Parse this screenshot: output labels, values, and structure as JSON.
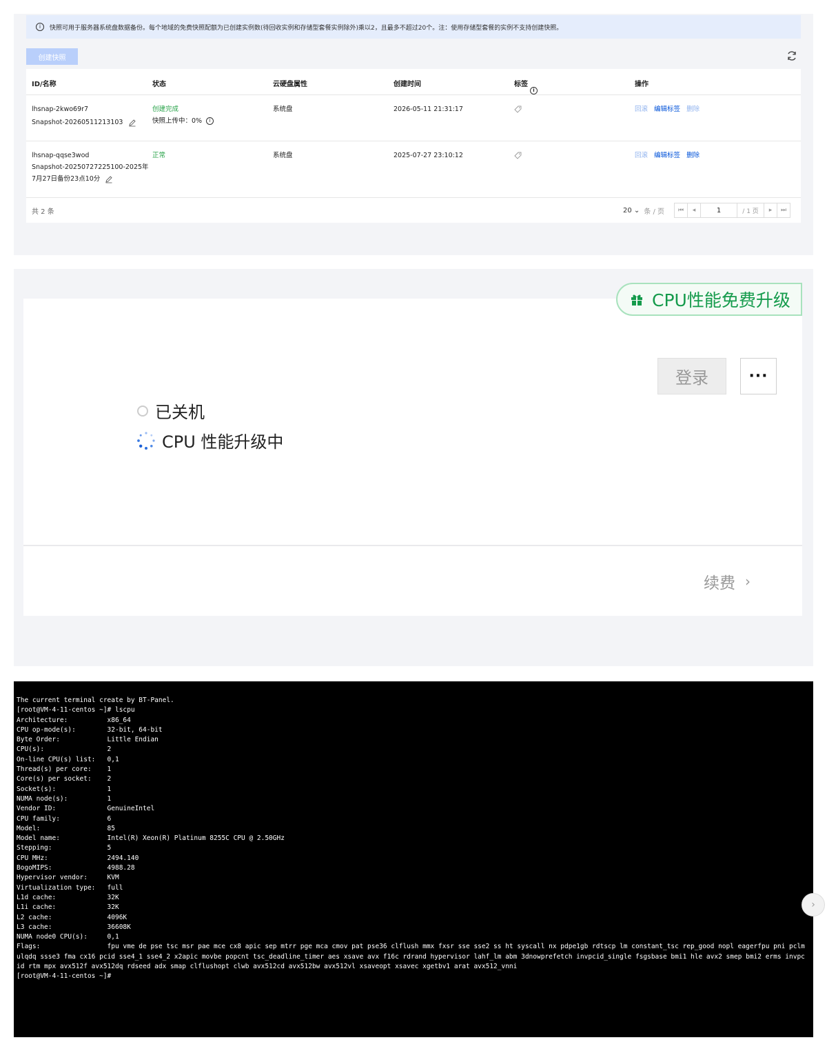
{
  "snapshots": {
    "notice": "快照可用于服务器系统盘数据备份。每个地域的免费快照配额为已创建实例数(待回收实例和存储型套餐实例除外)乘以2，且最多不超过20个。注：使用存储型套餐的实例不支持创建快照。",
    "create_button": "创建快照",
    "columns": [
      "ID/名称",
      "状态",
      "云硬盘属性",
      "创建时间",
      "标签",
      "操作"
    ],
    "rows": [
      {
        "id": "lhsnap-2kwo69r7",
        "name": "Snapshot-20260511213103",
        "name_line2": "",
        "status": "创建完成",
        "status_sub": "快照上传中：0%",
        "disk": "系统盘",
        "created": "2026-05-11 21:31:17",
        "ops": [
          "回滚",
          "编辑标签",
          "删除"
        ]
      },
      {
        "id": "lhsnap-qqse3wod",
        "name": "Snapshot-20250727225100-2025年",
        "name_line2": "7月27日备份23点10分",
        "status": "正常",
        "status_sub": "",
        "disk": "系统盘",
        "created": "2025-07-27 23:10:12",
        "ops": [
          "回滚",
          "编辑标签",
          "删除"
        ]
      }
    ],
    "total": "共 2 条",
    "page_size": "20",
    "per_page_unit": "条 / 页",
    "page": "1",
    "page_total": "/ 1 页"
  },
  "instance": {
    "upgrade_badge": "CPU性能免费升级",
    "login_button": "登录",
    "more_button": "···",
    "status": "已关机",
    "upgrading": "CPU 性能升级中",
    "renew": "续费"
  },
  "terminal": {
    "lines": [
      "The current terminal create by BT-Panel.",
      "[root@VM-4-11-centos ~]# lscpu",
      "Architecture:          x86_64",
      "CPU op-mode(s):        32-bit, 64-bit",
      "Byte Order:            Little Endian",
      "CPU(s):                2",
      "On-line CPU(s) list:   0,1",
      "Thread(s) per core:    1",
      "Core(s) per socket:    2",
      "Socket(s):             1",
      "NUMA node(s):          1",
      "Vendor ID:             GenuineIntel",
      "CPU family:            6",
      "Model:                 85",
      "Model name:            Intel(R) Xeon(R) Platinum 8255C CPU @ 2.50GHz",
      "Stepping:              5",
      "CPU MHz:               2494.140",
      "BogoMIPS:              4988.28",
      "Hypervisor vendor:     KVM",
      "Virtualization type:   full",
      "L1d cache:             32K",
      "L1i cache:             32K",
      "L2 cache:              4096K",
      "L3 cache:              36608K",
      "NUMA node0 CPU(s):     0,1"
    ],
    "flags": "Flags:                 fpu vme de pse tsc msr pae mce cx8 apic sep mtrr pge mca cmov pat pse36 clflush mmx fxsr sse sse2 ss ht syscall nx pdpe1gb rdtscp lm constant_tsc rep_good nopl eagerfpu pni pclmulqdq ssse3 fma cx16 pcid sse4_1 sse4_2 x2apic movbe popcnt tsc_deadline_timer aes xsave avx f16c rdrand hypervisor lahf_lm abm 3dnowprefetch invpcid_single fsgsbase bmi1 hle avx2 smep bmi2 erms invpcid rtm mpx avx512f avx512dq rdseed adx smap clflushopt clwb avx512cd avx512bw avx512vl xsaveopt xsavec xgetbv1 arat avx512_vnni",
    "prompt": "[root@VM-4-11-centos ~]#"
  },
  "colors": {
    "link": "#0052d9",
    "link_disabled": "#8fb2ee",
    "success": "#29a34a",
    "upgrade_green": "#159b4c",
    "notice_bg": "#e5edfc",
    "terminal_bg": "#000000"
  }
}
